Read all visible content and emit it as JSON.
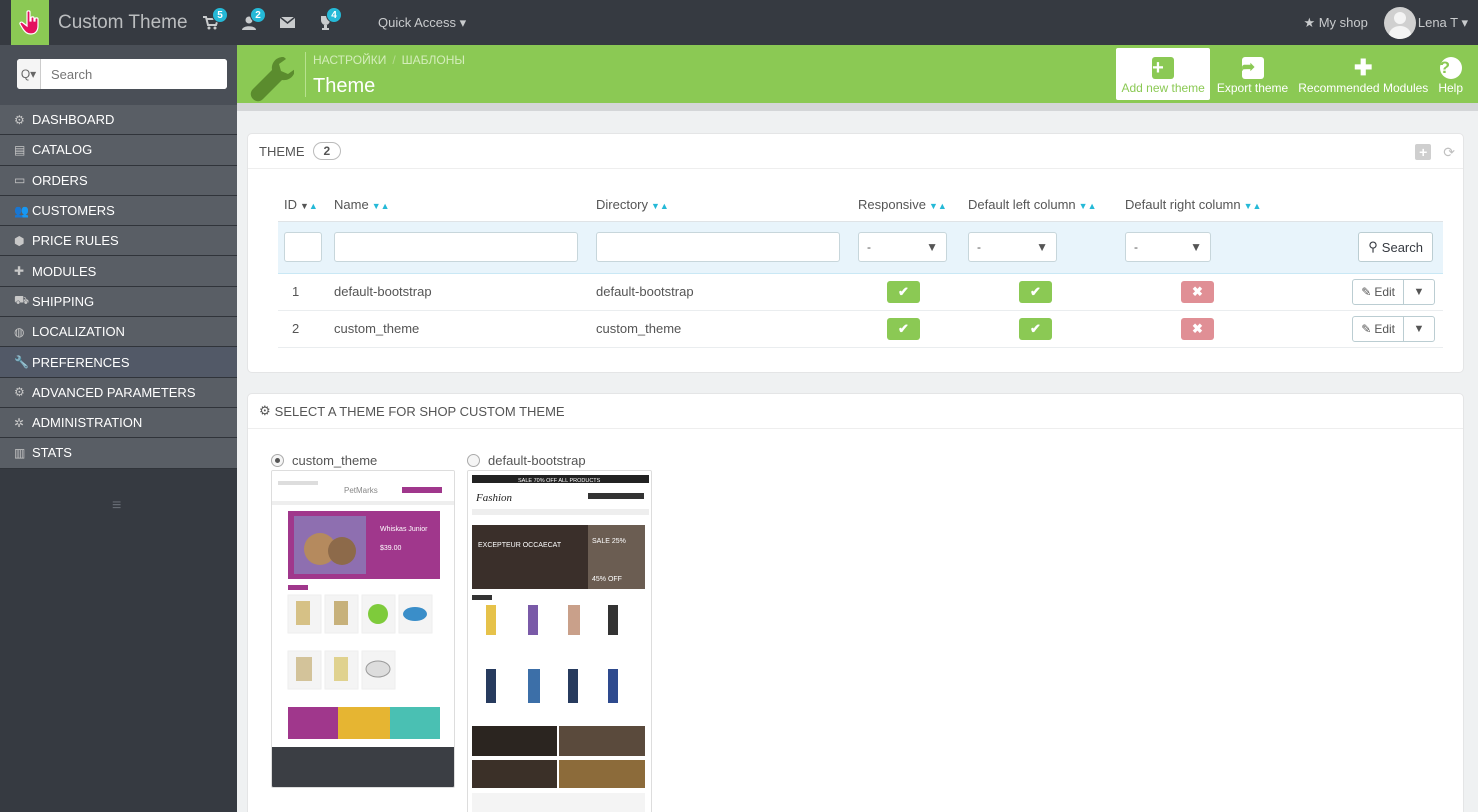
{
  "topbar": {
    "shop_name": "Custom Theme",
    "notifications": [
      {
        "icon": "cart-icon",
        "count": "5"
      },
      {
        "icon": "user-icon",
        "count": "2"
      },
      {
        "icon": "envelope-icon",
        "count": ""
      },
      {
        "icon": "trophy-icon",
        "count": "4"
      }
    ],
    "quick_access": "Quick Access",
    "my_shop": "★ My shop",
    "username": "Lena T ▾"
  },
  "sidebar": {
    "search_placeholder": "Search",
    "search_button": "Q▾",
    "items": [
      {
        "label": "DASHBOARD",
        "icon": "⚙"
      },
      {
        "label": "CATALOG",
        "icon": "▤"
      },
      {
        "label": "ORDERS",
        "icon": "▭"
      },
      {
        "label": "CUSTOMERS",
        "icon": "👥"
      },
      {
        "label": "PRICE RULES",
        "icon": "⬢"
      },
      {
        "label": "MODULES",
        "icon": "✚"
      },
      {
        "label": "SHIPPING",
        "icon": "⛟"
      },
      {
        "label": "LOCALIZATION",
        "icon": "◍"
      },
      {
        "label": "PREFERENCES",
        "icon": "🔧"
      },
      {
        "label": "ADVANCED PARAMETERS",
        "icon": "⚙"
      },
      {
        "label": "ADMINISTRATION",
        "icon": "✲"
      },
      {
        "label": "STATS",
        "icon": "▥"
      }
    ],
    "active_index": 8,
    "collapse_icon": "≡"
  },
  "header": {
    "breadcrumb": [
      "НАСТРОЙКИ",
      "ШАБЛОНЫ"
    ],
    "breadcrumb_sep": "/",
    "title": "Theme",
    "toolbar": [
      {
        "label": "Add new theme",
        "icon": "+"
      },
      {
        "label": "Export theme",
        "icon": "➦"
      },
      {
        "label": "Recommended Modules",
        "icon": "✚"
      },
      {
        "label": "Help",
        "icon": "?"
      }
    ]
  },
  "theme_list": {
    "heading": "THEME",
    "count": "2",
    "columns": [
      "ID",
      "Name",
      "Directory",
      "Responsive",
      "Default left column",
      "Default right column"
    ],
    "filter_select_value": "-",
    "search_button": "Search",
    "rows": [
      {
        "id": "1",
        "name": "default-bootstrap",
        "directory": "default-bootstrap",
        "responsive": "on",
        "left": "on",
        "right": "off"
      },
      {
        "id": "2",
        "name": "custom_theme",
        "directory": "custom_theme",
        "responsive": "on",
        "left": "on",
        "right": "off"
      }
    ],
    "edit_label": "Edit",
    "check_glyph": "✔",
    "cross_glyph": "✖"
  },
  "select_theme": {
    "heading": "SELECT A THEME FOR SHOP CUSTOM THEME",
    "options": [
      {
        "label": "custom_theme",
        "checked": true
      },
      {
        "label": "default-bootstrap",
        "checked": false
      }
    ],
    "thumb1": {
      "brand": "PetMarks",
      "promo_title": "Whiskas Junior",
      "promo_price": "$39.00"
    },
    "thumb2": {
      "banner": "SALE 70% OFF ALL PRODUCTS",
      "brand": "Fashion",
      "hero": "EXCEPTEUR OCCAECAT",
      "sale1": "SALE 25%",
      "sale2": "45% OFF"
    }
  },
  "colors": {
    "accent_green": "#8bc954",
    "topbar": "#363a41",
    "badge_blue": "#25b9d7",
    "cross_red": "#e08f95"
  }
}
